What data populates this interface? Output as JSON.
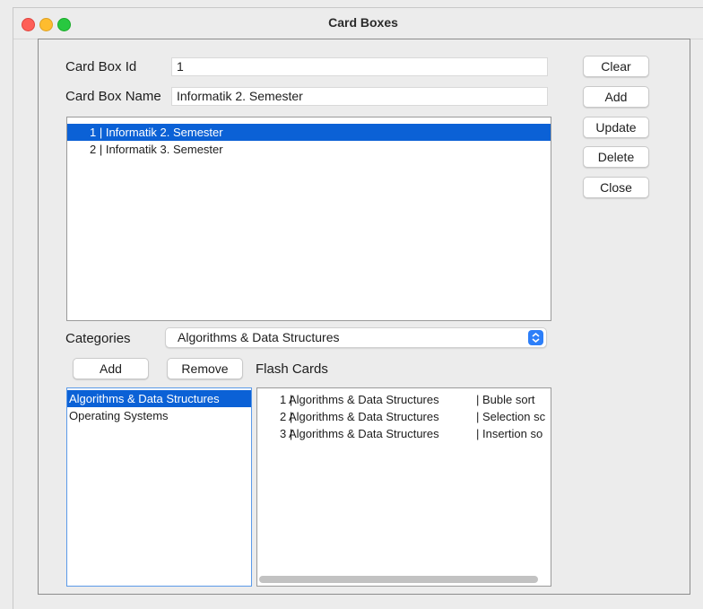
{
  "window": {
    "title": "Card Boxes"
  },
  "form": {
    "card_box_id_label": "Card Box Id",
    "card_box_id_value": "1",
    "card_box_name_label": "Card Box Name",
    "card_box_name_value": "Informatik 2. Semester"
  },
  "buttons": {
    "clear": "Clear",
    "add": "Add",
    "update": "Update",
    "delete": "Delete",
    "close": "Close"
  },
  "card_boxes": [
    {
      "text": "1 | Informatik 2. Semester",
      "selected": true
    },
    {
      "text": "2 | Informatik 3. Semester",
      "selected": false
    }
  ],
  "categories": {
    "label": "Categories",
    "selected": "Algorithms & Data Structures",
    "add_button": "Add",
    "remove_button": "Remove",
    "items": [
      {
        "text": "Algorithms & Data Structures",
        "selected": true
      },
      {
        "text": "Operating Systems",
        "selected": false
      }
    ]
  },
  "flash_cards": {
    "label": "Flash Cards",
    "rows": [
      {
        "id": "1 |",
        "category": "Algorithms & Data Structures",
        "title": "| Buble sort"
      },
      {
        "id": "2 |",
        "category": "Algorithms & Data Structures",
        "title": "| Selection sc"
      },
      {
        "id": "3 |",
        "category": "Algorithms & Data Structures",
        "title": "| Insertion so"
      }
    ]
  },
  "colors": {
    "selection": "#0b61d6",
    "close_dot": "#fe5f57",
    "minimize_dot": "#febc2e",
    "maximize_dot": "#28c840",
    "combo_arrow": "#2d7ff9"
  }
}
